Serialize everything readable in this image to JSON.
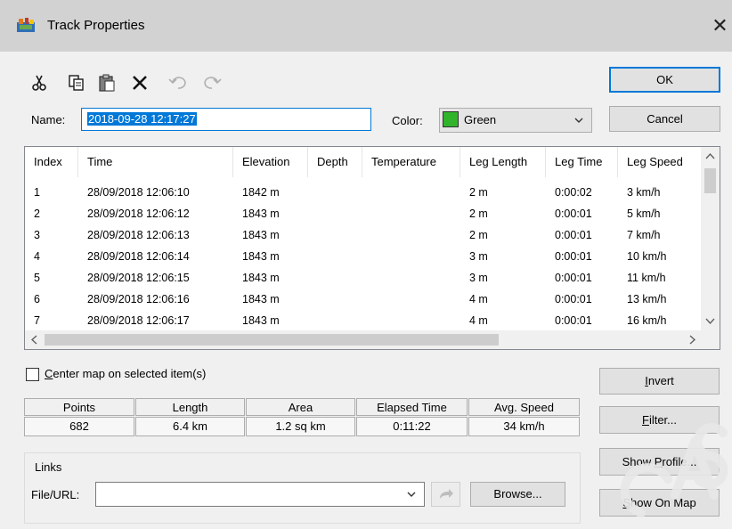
{
  "window": {
    "title": "Track Properties",
    "close_glyph": "✕",
    "icon": "track-properties-icon"
  },
  "toolbar": {
    "cut_icon": "scissors-icon",
    "copy_icon": "copy-icon",
    "paste_icon": "paste-icon",
    "delete_icon": "delete-x-icon",
    "undo_icon": "undo-icon",
    "redo_icon": "redo-icon"
  },
  "buttons": {
    "ok": "OK",
    "cancel": "Cancel",
    "invert": "Invert",
    "filter": "Filter...",
    "show_profile": "Show Profile...",
    "show_on_map": "Show On Map",
    "browse": "Browse..."
  },
  "name_field": {
    "label": "Name:",
    "value": "2018-09-28 12:17:27"
  },
  "color_field": {
    "label": "Color:",
    "value": "Green",
    "swatch": "#31b42c"
  },
  "table": {
    "columns": [
      "Index",
      "Time",
      "Elevation",
      "Depth",
      "Temperature",
      "Leg Length",
      "Leg Time",
      "Leg Speed"
    ],
    "rows": [
      {
        "index": "1",
        "time": "28/09/2018 12:06:10",
        "elevation": "1842 m",
        "depth": "",
        "temperature": "",
        "leg_length": "2 m",
        "leg_time": "0:00:02",
        "leg_speed": "3 km/h"
      },
      {
        "index": "2",
        "time": "28/09/2018 12:06:12",
        "elevation": "1843 m",
        "depth": "",
        "temperature": "",
        "leg_length": "2 m",
        "leg_time": "0:00:01",
        "leg_speed": "5 km/h"
      },
      {
        "index": "3",
        "time": "28/09/2018 12:06:13",
        "elevation": "1843 m",
        "depth": "",
        "temperature": "",
        "leg_length": "2 m",
        "leg_time": "0:00:01",
        "leg_speed": "7 km/h"
      },
      {
        "index": "4",
        "time": "28/09/2018 12:06:14",
        "elevation": "1843 m",
        "depth": "",
        "temperature": "",
        "leg_length": "3 m",
        "leg_time": "0:00:01",
        "leg_speed": "10 km/h"
      },
      {
        "index": "5",
        "time": "28/09/2018 12:06:15",
        "elevation": "1843 m",
        "depth": "",
        "temperature": "",
        "leg_length": "3 m",
        "leg_time": "0:00:01",
        "leg_speed": "11 km/h"
      },
      {
        "index": "6",
        "time": "28/09/2018 12:06:16",
        "elevation": "1843 m",
        "depth": "",
        "temperature": "",
        "leg_length": "4 m",
        "leg_time": "0:00:01",
        "leg_speed": "13 km/h"
      },
      {
        "index": "7",
        "time": "28/09/2018 12:06:17",
        "elevation": "1843 m",
        "depth": "",
        "temperature": "",
        "leg_length": "4 m",
        "leg_time": "0:00:01",
        "leg_speed": "16 km/h"
      }
    ]
  },
  "center_map": {
    "label": "Center map on selected item(s)",
    "checked": false
  },
  "stats": {
    "headers": [
      "Points",
      "Length",
      "Area",
      "Elapsed Time",
      "Avg. Speed"
    ],
    "values": [
      "682",
      "6.4 km",
      "1.2 sq km",
      "0:11:22",
      "34 km/h"
    ]
  },
  "links": {
    "group_label": "Links",
    "file_url_label": "File/URL:",
    "file_url_value": ""
  }
}
